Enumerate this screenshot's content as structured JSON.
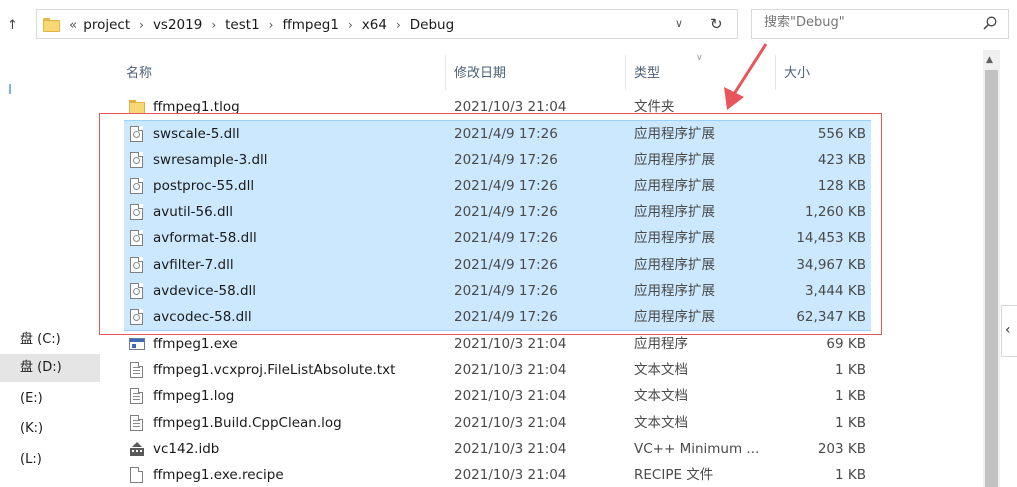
{
  "address": {
    "overflow": "«",
    "crumbs": [
      "project",
      "vs2019",
      "test1",
      "ffmpeg1",
      "x64",
      "Debug"
    ]
  },
  "search": {
    "placeholder": "搜索\"Debug\""
  },
  "nav": {
    "drives": [
      "盘 (C:)",
      "盘 (D:)",
      "(E:)",
      "(K:)",
      "(L:)"
    ],
    "selected_index": 1
  },
  "columns": {
    "name": "名称",
    "date": "修改日期",
    "type": "类型",
    "size": "大小"
  },
  "files": [
    {
      "icon": "folder-icon",
      "name": "ffmpeg1.tlog",
      "date": "2021/10/3 21:04",
      "type": "文件夹",
      "size": "",
      "selected": false
    },
    {
      "icon": "dll-icon",
      "name": "swscale-5.dll",
      "date": "2021/4/9 17:26",
      "type": "应用程序扩展",
      "size": "556 KB",
      "selected": true
    },
    {
      "icon": "dll-icon",
      "name": "swresample-3.dll",
      "date": "2021/4/9 17:26",
      "type": "应用程序扩展",
      "size": "423 KB",
      "selected": true
    },
    {
      "icon": "dll-icon",
      "name": "postproc-55.dll",
      "date": "2021/4/9 17:26",
      "type": "应用程序扩展",
      "size": "128 KB",
      "selected": true
    },
    {
      "icon": "dll-icon",
      "name": "avutil-56.dll",
      "date": "2021/4/9 17:26",
      "type": "应用程序扩展",
      "size": "1,260 KB",
      "selected": true
    },
    {
      "icon": "dll-icon",
      "name": "avformat-58.dll",
      "date": "2021/4/9 17:26",
      "type": "应用程序扩展",
      "size": "14,453 KB",
      "selected": true
    },
    {
      "icon": "dll-icon",
      "name": "avfilter-7.dll",
      "date": "2021/4/9 17:26",
      "type": "应用程序扩展",
      "size": "34,967 KB",
      "selected": true
    },
    {
      "icon": "dll-icon",
      "name": "avdevice-58.dll",
      "date": "2021/4/9 17:26",
      "type": "应用程序扩展",
      "size": "3,444 KB",
      "selected": true
    },
    {
      "icon": "dll-icon",
      "name": "avcodec-58.dll",
      "date": "2021/4/9 17:26",
      "type": "应用程序扩展",
      "size": "62,347 KB",
      "selected": true
    },
    {
      "icon": "exe-icon",
      "name": "ffmpeg1.exe",
      "date": "2021/10/3 21:04",
      "type": "应用程序",
      "size": "69 KB",
      "selected": false
    },
    {
      "icon": "text-file-icon",
      "name": "ffmpeg1.vcxproj.FileListAbsolute.txt",
      "date": "2021/10/3 21:04",
      "type": "文本文档",
      "size": "1 KB",
      "selected": false
    },
    {
      "icon": "text-file-icon",
      "name": "ffmpeg1.log",
      "date": "2021/10/3 21:04",
      "type": "文本文档",
      "size": "1 KB",
      "selected": false
    },
    {
      "icon": "text-file-icon",
      "name": "ffmpeg1.Build.CppClean.log",
      "date": "2021/10/3 21:04",
      "type": "文本文档",
      "size": "1 KB",
      "selected": false
    },
    {
      "icon": "idb-icon",
      "name": "vc142.idb",
      "date": "2021/10/3 21:04",
      "type": "VC++ Minimum ...",
      "size": "203 KB",
      "selected": false
    },
    {
      "icon": "file-icon",
      "name": "ffmpeg1.exe.recipe",
      "date": "2021/10/3 21:04",
      "type": "RECIPE 文件",
      "size": "1 KB",
      "selected": false
    }
  ],
  "colors": {
    "selection_bg": "#cce8ff",
    "selection_border": "#99d1ff",
    "annotation_red": "#e8555a",
    "header_text": "#4c607a"
  }
}
